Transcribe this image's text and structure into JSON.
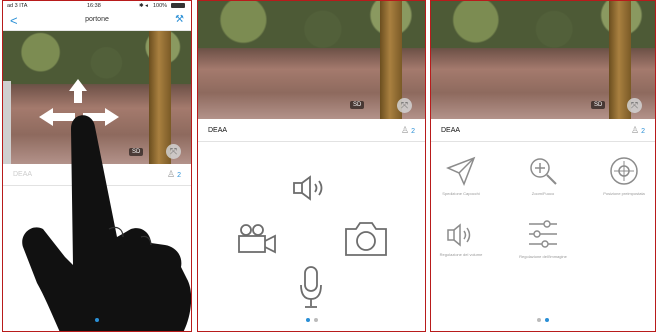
{
  "panel1": {
    "status": {
      "carrier": "ad 3 ITA",
      "time": "16:38",
      "battery": "100%"
    },
    "nav": {
      "back": "<",
      "title": "portone"
    },
    "camera": {
      "quality": "SD"
    },
    "device": {
      "name": "DEAA",
      "user_count": "2"
    }
  },
  "panel2": {
    "camera": {
      "quality": "SD"
    },
    "device": {
      "name": "DEAA",
      "user_count": "2"
    }
  },
  "panel3": {
    "camera": {
      "quality": "SD"
    },
    "device": {
      "name": "DEAA",
      "user_count": "2"
    },
    "tools": [
      {
        "label": "Spedizione Capocchi",
        "icon": "paper-plane-icon"
      },
      {
        "label": "Zoom/Fuoco",
        "icon": "zoom-icon"
      },
      {
        "label": "Posizione preimpostata",
        "icon": "preset-position-icon"
      },
      {
        "label": "Regolazione del volume",
        "icon": "speaker-icon"
      },
      {
        "label": "Regolazione dell'immagine",
        "icon": "sliders-icon"
      }
    ]
  },
  "colors": {
    "accent": "#2a8fd6",
    "frame": "#b81b1b",
    "icon_gray": "#8c8c8c"
  }
}
